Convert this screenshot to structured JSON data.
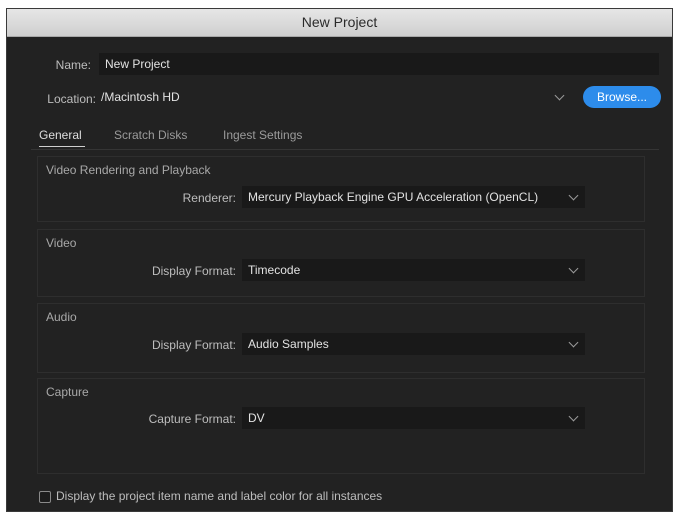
{
  "window": {
    "title": "New Project"
  },
  "name_row": {
    "label": "Name:",
    "value": "New Project"
  },
  "location_row": {
    "label": "Location:",
    "value": "/Macintosh HD",
    "browse_label": "Browse..."
  },
  "tabs": [
    {
      "label": "General",
      "active": true
    },
    {
      "label": "Scratch Disks",
      "active": false
    },
    {
      "label": "Ingest Settings",
      "active": false
    }
  ],
  "sections": {
    "video_rendering": {
      "title": "Video Rendering and Playback",
      "field_label": "Renderer:",
      "value": "Mercury Playback Engine GPU Acceleration (OpenCL)"
    },
    "video": {
      "title": "Video",
      "field_label": "Display Format:",
      "value": "Timecode"
    },
    "audio": {
      "title": "Audio",
      "field_label": "Display Format:",
      "value": "Audio Samples"
    },
    "capture": {
      "title": "Capture",
      "field_label": "Capture Format:",
      "value": "DV"
    }
  },
  "checkbox": {
    "label": "Display the project item name and label color for all instances",
    "checked": false
  },
  "colors": {
    "accent": "#2d8ceb",
    "background": "#222222",
    "field": "#191919"
  },
  "icons": {
    "dropdown": "chevron-down-icon",
    "checkbox": "checkbox-icon"
  }
}
